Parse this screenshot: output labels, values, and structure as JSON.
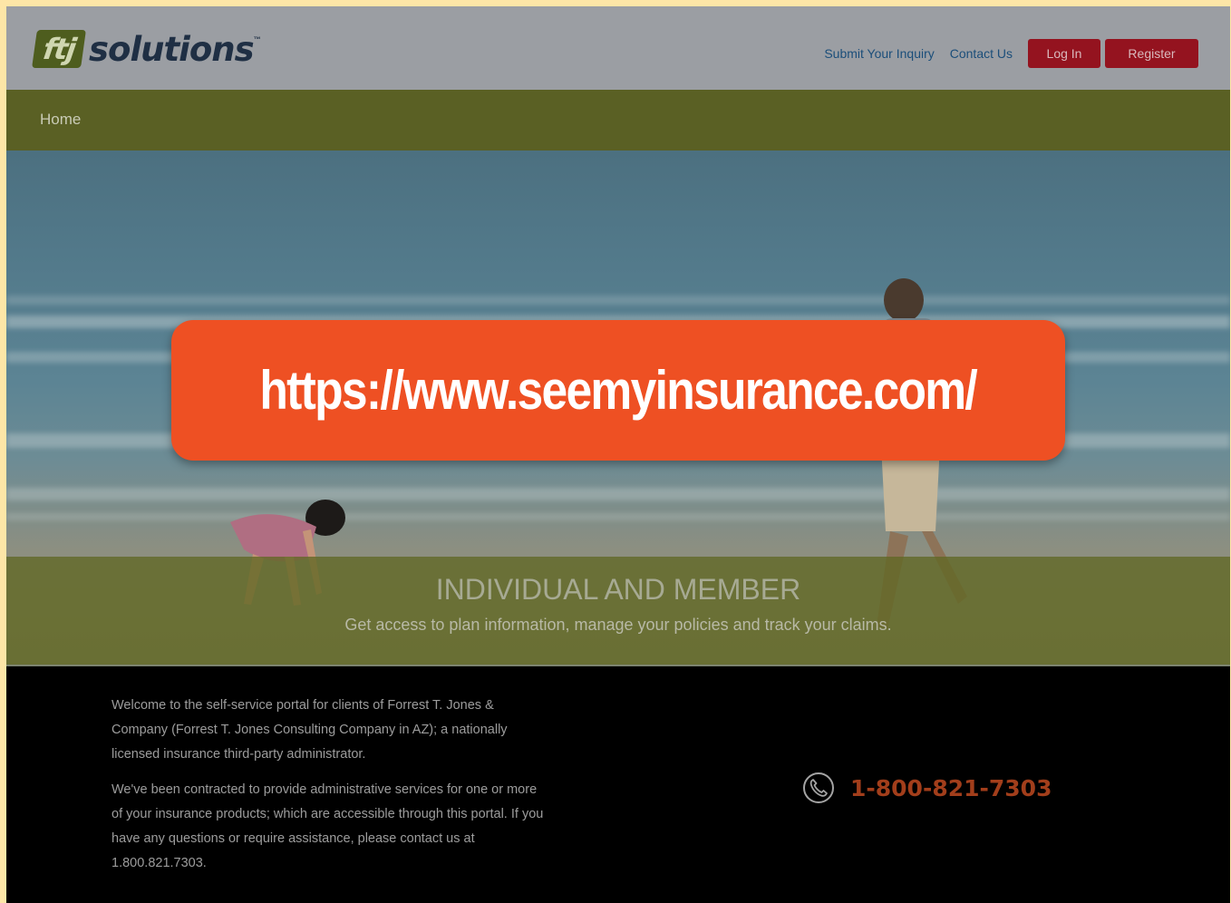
{
  "header": {
    "logo_mark": "ftj",
    "logo_word": "solutions",
    "logo_tm": "™",
    "links": {
      "submit_inquiry": "Submit Your Inquiry",
      "contact_us": "Contact Us"
    },
    "login_label": "Log In",
    "register_label": "Register"
  },
  "nav": {
    "home": "Home"
  },
  "hero": {
    "title": "INDIVIDUAL AND MEMBER",
    "subtitle": "Get access to plan information, manage your policies and track your claims."
  },
  "banner": {
    "url": "https://www.seemyinsurance.com/"
  },
  "footer": {
    "welcome": "Welcome to the self-service portal for clients of Forrest T. Jones & Company (Forrest T. Jones Consulting Company in AZ); a nationally licensed insurance third-party administrator.",
    "contracted": "We've been contracted to provide administrative services for one or more of your insurance products; which are accessible through this portal. If you have any questions or require assistance, please contact us at 1.800.821.7303.",
    "phone": "1-800-821-7303"
  },
  "colors": {
    "page_border": "#fde6a7",
    "header_bg": "#9b9ea3",
    "nav_bg": "#5a6024",
    "button_bg": "#94131f",
    "banner_bg": "#ee5023",
    "phone_color": "#a23e1b"
  },
  "icons": [
    "phone-icon"
  ]
}
